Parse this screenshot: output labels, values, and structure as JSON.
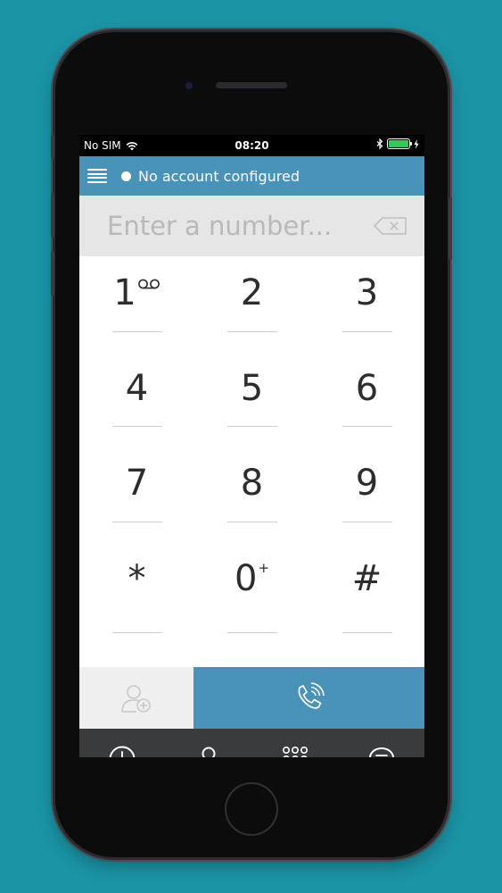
{
  "status_bar": {
    "carrier": "No SIM",
    "time": "08:20"
  },
  "header": {
    "account_status": "No account configured"
  },
  "dialer": {
    "placeholder": "Enter a number..."
  },
  "keypad": [
    {
      "digit": "1",
      "sub": ""
    },
    {
      "digit": "2",
      "sub": ""
    },
    {
      "digit": "3",
      "sub": ""
    },
    {
      "digit": "4",
      "sub": ""
    },
    {
      "digit": "5",
      "sub": ""
    },
    {
      "digit": "6",
      "sub": ""
    },
    {
      "digit": "7",
      "sub": ""
    },
    {
      "digit": "8",
      "sub": ""
    },
    {
      "digit": "9",
      "sub": ""
    },
    {
      "digit": "*",
      "sub": ""
    },
    {
      "digit": "0",
      "sub": "+"
    },
    {
      "digit": "#",
      "sub": ""
    }
  ],
  "icons": {
    "menu": "menu-icon",
    "backspace": "backspace-icon",
    "voicemail": "voicemail-icon",
    "add_contact": "add-contact-icon",
    "call": "phone-icon",
    "tabs": [
      "clock-icon",
      "person-icon",
      "keypad-icon",
      "chat-icon"
    ]
  },
  "colors": {
    "accent": "#4a93b8",
    "background": "#1b94a6",
    "tab_bar": "#3a3b3d",
    "battery": "#35c759"
  },
  "tab_bar": {
    "active_index": 2
  }
}
